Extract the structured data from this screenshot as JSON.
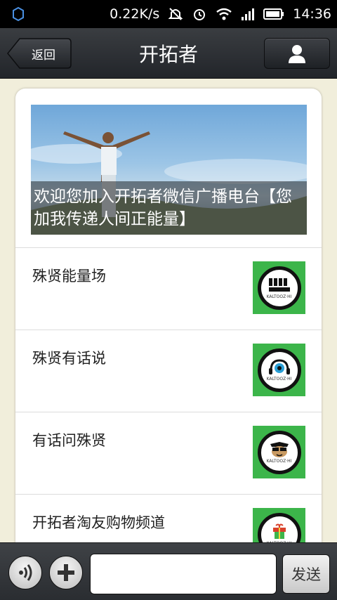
{
  "status_bar": {
    "network_speed": "0.22K/s",
    "time": "14:36",
    "icons": [
      "app-notification-icon",
      "mute-icon",
      "alarm-icon",
      "wifi-icon",
      "signal-icon",
      "battery-icon"
    ]
  },
  "header": {
    "back_label": "返回",
    "title": "开拓者",
    "profile_icon": "person-icon"
  },
  "banner": {
    "caption": "欢迎您加入开拓者微信广播电台【您加我传递人间正能量】"
  },
  "list": [
    {
      "label": "殊贤能量场",
      "icon": "fist-logo-icon"
    },
    {
      "label": "殊贤有话说",
      "icon": "headphones-logo-icon"
    },
    {
      "label": "有话问殊贤",
      "icon": "monkey-face-logo-icon"
    },
    {
      "label": "开拓者淘友购物频道",
      "icon": "gift-logo-icon"
    }
  ],
  "thumb_brand": "KALTOOZ·HI",
  "composer": {
    "input_value": "",
    "send_label": "发送"
  },
  "colors": {
    "background": "#f1eedb",
    "thumb_green": "#3cb54a",
    "bar_dark": "#2a2d31"
  }
}
